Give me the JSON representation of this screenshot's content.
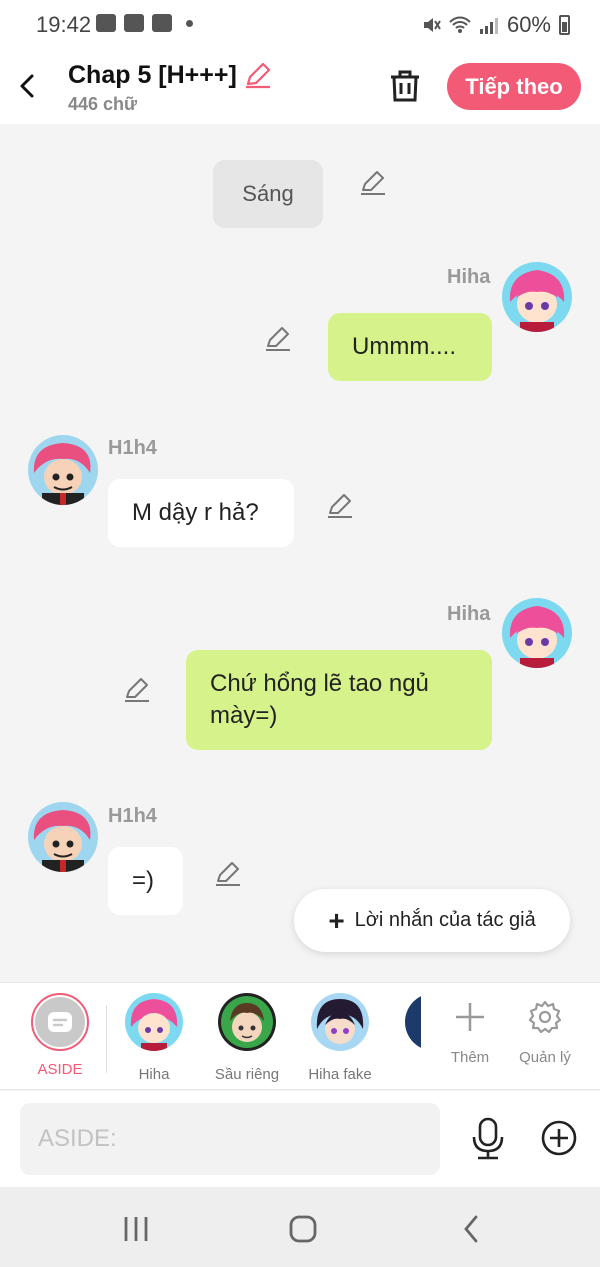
{
  "status_bar": {
    "time": "19:42",
    "battery": "60%"
  },
  "header": {
    "title": "Chap 5 [H+++]",
    "subtitle": "446 chữ",
    "next_label": "Tiếp theo"
  },
  "messages": [
    {
      "type": "narration",
      "text": "Sáng"
    },
    {
      "type": "right",
      "sender": "Hiha",
      "text": "Ummm...."
    },
    {
      "type": "left",
      "sender": "H1h4",
      "text": "M dậy r hả?"
    },
    {
      "type": "right",
      "sender": "Hiha",
      "text": "Chứ hổng lẽ tao ngủ mày=)"
    },
    {
      "type": "left",
      "sender": "H1h4",
      "text": "=)"
    }
  ],
  "author_note_label": "Lời nhắn của tác giả",
  "characters": [
    {
      "label": "ASIDE"
    },
    {
      "label": "Hiha"
    },
    {
      "label": "Sầu riêng"
    },
    {
      "label": "Hiha fake"
    }
  ],
  "tools": {
    "add_label": "Thêm",
    "manage_label": "Quản lý"
  },
  "input": {
    "placeholder": "ASIDE:"
  },
  "colors": {
    "accent": "#f25a75",
    "right_bubble": "#d6f28b",
    "left_bubble": "#ffffff",
    "narration_bubble": "#e6e6e6"
  }
}
